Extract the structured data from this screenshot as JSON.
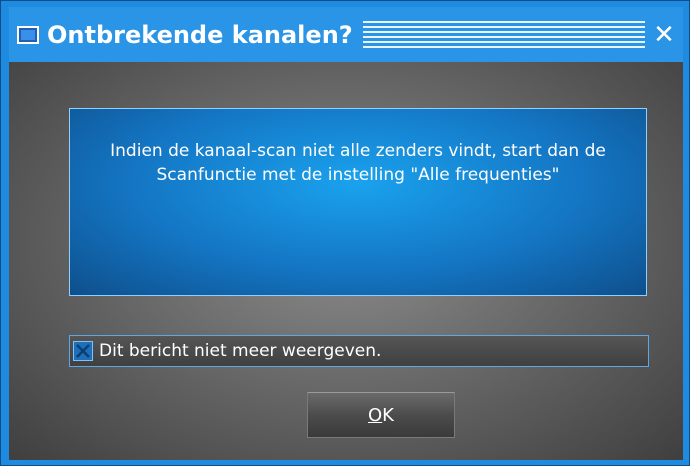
{
  "window": {
    "title": "Ontbrekende kanalen?",
    "close_glyph": "✕",
    "icon": "window-icon",
    "accent_color": "#1e8be0"
  },
  "message": {
    "text": "Indien de kanaal-scan niet alle zenders vindt, start dan de Scanfunctie met de instelling \"Alle frequenties\""
  },
  "checkbox": {
    "label": "Dit bericht niet meer weergeven.",
    "checked": true
  },
  "buttons": {
    "ok_mnemonic": "O",
    "ok_rest": "K"
  }
}
